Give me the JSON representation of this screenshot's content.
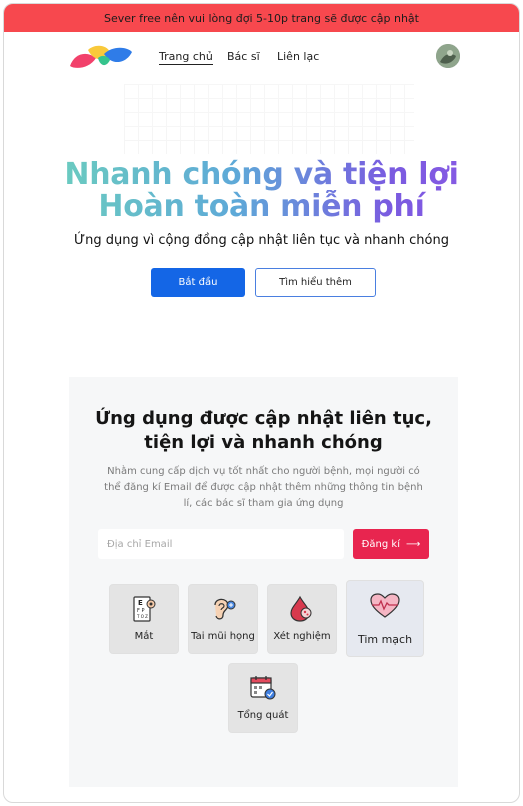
{
  "banner": {
    "text": "Sever free nên vui lòng đợi 5-10p trang sẽ được cập nhật"
  },
  "nav": {
    "links": [
      {
        "label": "Trang chủ"
      },
      {
        "label": "Bác sĩ"
      },
      {
        "label": "Liên lạc"
      }
    ]
  },
  "hero": {
    "title_line1": "Nhanh chóng và tiện lợi",
    "title_line2": "Hoàn toàn miễn phí",
    "subtitle": "Ứng dụng vì cộng đồng cập nhật liên tục và nhanh chóng",
    "primary_button": "Bắt đầu",
    "secondary_button": "Tìm hiểu thêm"
  },
  "subscribe": {
    "title_line1": "Ứng dụng được cập nhật liên tục,",
    "title_line2": "tiện lợi và nhanh chóng",
    "description": "Nhằm cung cấp dịch vụ tốt nhất cho người bệnh, mọi người có thể đăng kí Email để được cập nhật thêm những thông tin bệnh lí, các bác sĩ tham gia ứng dụng",
    "email_placeholder": "Địa chỉ Email",
    "signup_button": "Đăng kí",
    "signup_arrow": "⟶"
  },
  "categories": [
    {
      "label": "Mắt",
      "icon": "eye-chart-icon"
    },
    {
      "label": "Tai mũi họng",
      "icon": "ear-icon"
    },
    {
      "label": "Xét nghiệm",
      "icon": "blood-drop-icon"
    },
    {
      "label": "Tim mạch",
      "icon": "heart-pulse-icon"
    },
    {
      "label": "Tổng quát",
      "icon": "calendar-check-icon"
    }
  ],
  "colors": {
    "banner": "#f7484e",
    "primary": "#1466e6",
    "signup": "#e8254f"
  }
}
